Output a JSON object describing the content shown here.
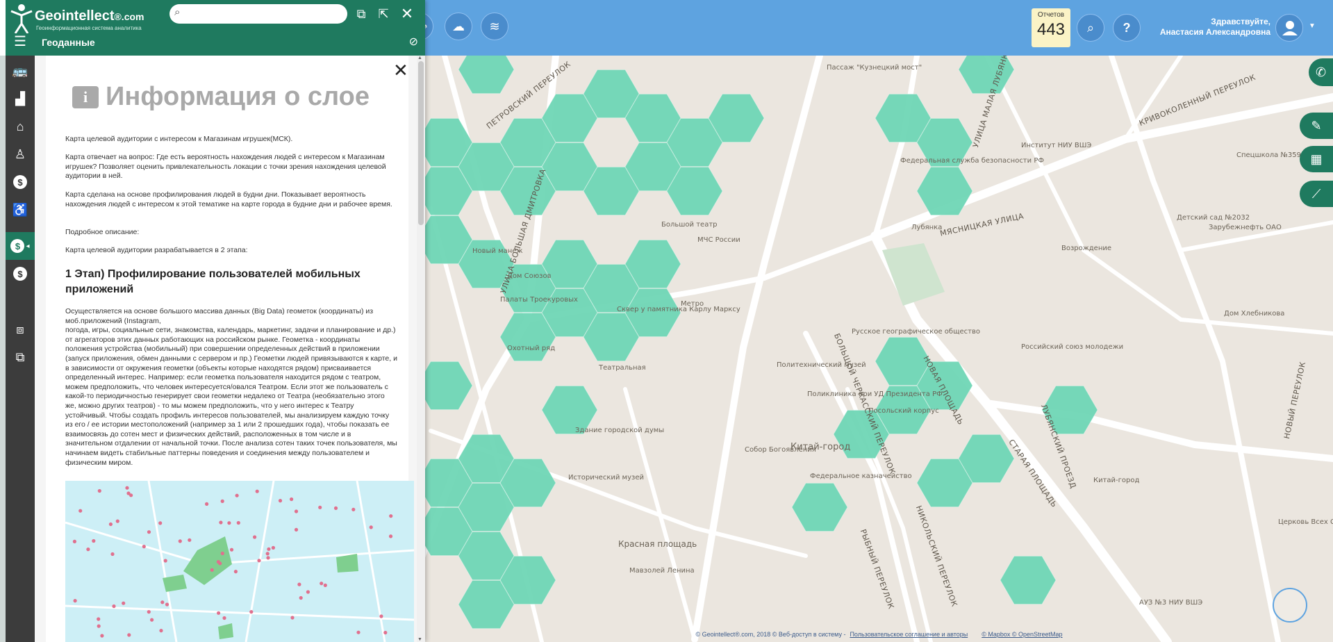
{
  "header": {
    "brand": "Geointellect",
    "brand_suffix": "®.com",
    "tagline": "Геоинформационная система аналитика",
    "search_placeholder": "",
    "menu_title": "Геоданные"
  },
  "topbar": {
    "reports_label": "Отчетов",
    "reports_count": "443",
    "greeting_line1": "Здравствуйте,",
    "greeting_line2": "Анастасия Александровна"
  },
  "info": {
    "title": "Информация о слое",
    "p1": "Карта целевой аудитории с интересом к Магазинам игрушек(МСК).",
    "p2": "Карта отвечает на вопрос: Где есть вероятность нахождения людей с интересом к Магазинам игрушек? Позволяет оценить привлекательность локации с точки зрения нахождения целевой аудитории в ней.",
    "p3": "Карта сделана на основе профилирования людей в будни дни. Показывает вероятность нахождения людей с интересом к этой тематике на карте города в будние дни и рабочее время.",
    "p4": "Подробное описание:",
    "p5": "Карта целевой аудитории разрабатывается в 2 этапа:",
    "stage1": "1 Этап) Профилирование пользователей мобильных приложений",
    "p6": "Осуществляется на основе большого массива данных (Big Data) геометок (координаты) из моб.приложений (Instagram,\nпогода, игры, социальные сети, знакомства, календарь, маркетинг, задачи и планирование и др.) от агрегаторов этих данных работающих на российском рынке. Геометка - координаты положения устройства (мобильный) при совершении определенных действий в приложении (запуск приложения, обмен данными с сервером и пр.) Геометки людей привязываются к карте, и в зависимости от окружения геометки (объекты которые находятся рядом) присваивается определенный интерес. Например: если геометка пользователя находится рядом с театром, можем предположить, что человек интересуется/овался Театром. Если этот же пользователь с какой-то периодичностью генерирует свои геометки недалеко от Театра (необязательно этого же, можно других театров) - то мы можем предположить, что у него интерес к Театру устойчивый.  Чтобы создать профиль интересов пользователей, мы анализируем каждую точку из его / ее истории местоположений (например за 1 или 2 прошедших года), чтобы показать ее взаимосвязь до сотен мест и физических действий, расположенных в том числе и в значительном отдалении от начальной точки. После анализа сотен таких точек пользователя, мы начинаем видеть стабильные паттерны поведения и соединения между пользователем и физическим миром."
  },
  "map_labels": {
    "streets": [
      "УЛИЦА БОЛЬШАЯ ДМИТРОВКА",
      "ПЕТРОВСКИЙ ПЕРЕУЛОК",
      "МЯСНИЦКАЯ УЛИЦА",
      "НОВАЯ ПЛОЩАДЬ",
      "СТАРАЯ ПЛОЩАДЬ",
      "БОЛЬШОЙ ЧЕРКАССКИЙ ПЕРЕУЛОК",
      "НИКОЛЬСКИЙ ПЕРЕУЛОК",
      "РЫБНЫЙ ПЕРЕУЛОК",
      "УЛИЦА МАЛАЯ ЛУБЯНКА",
      "КРИВОКОЛЕННЫЙ ПЕРЕУЛОК",
      "ЛУБЯНСКИЙ ПРОЕЗД",
      "НОВЫЙ ПЕРЕУЛОК"
    ],
    "places": [
      "Пассаж \"Кузнецкий мост\"",
      "Федеральная служба безопасности РФ",
      "Лубянка",
      "Новый манеж",
      "МЧС России",
      "Дом Союзов",
      "Палаты Троекуровых",
      "Сквер у памятника Карлу Марксу",
      "Метро",
      "Охотный ряд",
      "Театральная",
      "Русское географическое общество",
      "Российский союз молодежи",
      "Политехнический музей",
      "Поликлиника при УД Президента РФ",
      "Здание городской думы",
      "Собор Богоявления",
      "Китай-город",
      "Федеральное казначейство",
      "Исторический музей",
      "Красная площадь",
      "Мавзолей Ленина",
      "Спецшкола №359",
      "Детский сад №2032",
      "Зарубежнефть ОАО",
      "Возрождение",
      "Дом Хлебникова",
      "Китай-город",
      "АУЗ №3 НИУ ВШЭ",
      "Церковь Всех Святых",
      "Институт НИУ ВШЭ",
      "Большой театр",
      "Посольский корпус"
    ]
  },
  "footer": {
    "copyright": "© Geointellect®.com, 2018 © Веб-доступ в систему -",
    "terms_link": "Пользовательское соглашение и авторы",
    "mapbox_link": "© Mapbox © OpenStreetMap"
  },
  "colors": {
    "hex_fill": "#6fd6b5",
    "panel_green": "#1f7a5f",
    "topbar_blue": "#5ea3e0",
    "reports_bg": "#fbf3c6"
  },
  "icons": {
    "sidebar": [
      "bus-icon",
      "chart-icon",
      "bank-icon",
      "person-icon",
      "coin-icon",
      "walker-icon",
      "coin-active-icon",
      "coin-icon-2",
      "layers-compare-icon",
      "copy-icon"
    ]
  }
}
